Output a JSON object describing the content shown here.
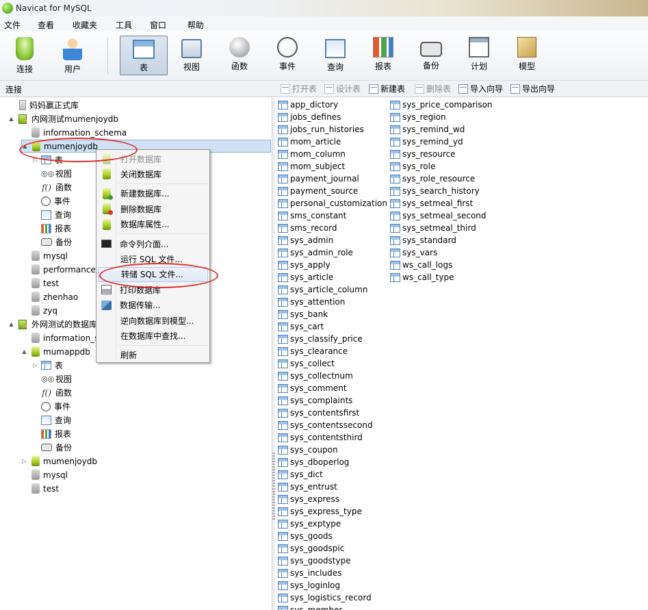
{
  "window": {
    "title": "Navicat for MySQL"
  },
  "menubar": [
    "文件",
    "查看",
    "收藏夹",
    "工具",
    "窗口",
    "帮助"
  ],
  "toolbar": [
    {
      "label": "连接",
      "icon": "connect-icon"
    },
    {
      "label": "用户",
      "icon": "user-icon"
    },
    {
      "label": "表",
      "icon": "table-icon",
      "active": true
    },
    {
      "label": "视图",
      "icon": "view-icon"
    },
    {
      "label": "函数",
      "icon": "function-icon"
    },
    {
      "label": "事件",
      "icon": "event-icon"
    },
    {
      "label": "查询",
      "icon": "query-icon"
    },
    {
      "label": "报表",
      "icon": "report-icon"
    },
    {
      "label": "备份",
      "icon": "backup-icon"
    },
    {
      "label": "计划",
      "icon": "schedule-icon"
    },
    {
      "label": "模型",
      "icon": "model-icon"
    }
  ],
  "subbar": {
    "connection_label": "连接",
    "actions": [
      {
        "label": "打开表",
        "enabled": false
      },
      {
        "label": "设计表",
        "enabled": false
      },
      {
        "label": "新建表",
        "enabled": true
      },
      {
        "label": "删除表",
        "enabled": false
      },
      {
        "label": "导入向导",
        "enabled": true
      },
      {
        "label": "导出向导",
        "enabled": true
      }
    ]
  },
  "tree": [
    {
      "label": "妈妈赢正式库",
      "icon": "connection-gray-icon",
      "level": 0,
      "expander": ""
    },
    {
      "label": "内网测试mumenjoydb",
      "icon": "connection-green-icon",
      "level": 0,
      "expander": "▲"
    },
    {
      "label": "information_schema",
      "icon": "database-gray-icon",
      "level": 1,
      "expander": ""
    },
    {
      "label": "mumenjoydb",
      "icon": "database-green-icon",
      "level": 1,
      "expander": "▲",
      "selected": true
    },
    {
      "label": "表",
      "icon": "table-icon",
      "level": 2,
      "expander": "▷"
    },
    {
      "label": "视图",
      "icon": "view-icon",
      "level": 2,
      "expander": ""
    },
    {
      "label": "函数",
      "icon": "function-icon",
      "level": 2,
      "expander": ""
    },
    {
      "label": "事件",
      "icon": "event-icon",
      "level": 2,
      "expander": ""
    },
    {
      "label": "查询",
      "icon": "query-icon",
      "level": 2,
      "expander": ""
    },
    {
      "label": "报表",
      "icon": "report-icon",
      "level": 2,
      "expander": ""
    },
    {
      "label": "备份",
      "icon": "backup-icon",
      "level": 2,
      "expander": ""
    },
    {
      "label": "mysql",
      "icon": "database-gray-icon",
      "level": 1,
      "expander": ""
    },
    {
      "label": "performance_",
      "icon": "database-gray-icon",
      "level": 1,
      "expander": ""
    },
    {
      "label": "test",
      "icon": "database-gray-icon",
      "level": 1,
      "expander": ""
    },
    {
      "label": "zhenhao",
      "icon": "database-gray-icon",
      "level": 1,
      "expander": ""
    },
    {
      "label": "zyq",
      "icon": "database-gray-icon",
      "level": 1,
      "expander": ""
    },
    {
      "label": "外网测试的数据库",
      "icon": "connection-green-icon",
      "level": 0,
      "expander": "▲"
    },
    {
      "label": "information_s",
      "icon": "database-gray-icon",
      "level": 1,
      "expander": ""
    },
    {
      "label": "mumappdb",
      "icon": "database-green-icon",
      "level": 1,
      "expander": "▲"
    },
    {
      "label": "表",
      "icon": "table-icon",
      "level": 2,
      "expander": "▷"
    },
    {
      "label": "视图",
      "icon": "view-icon",
      "level": 2,
      "expander": ""
    },
    {
      "label": "函数",
      "icon": "function-icon",
      "level": 2,
      "expander": ""
    },
    {
      "label": "事件",
      "icon": "event-icon",
      "level": 2,
      "expander": ""
    },
    {
      "label": "查询",
      "icon": "query-icon",
      "level": 2,
      "expander": ""
    },
    {
      "label": "报表",
      "icon": "report-icon",
      "level": 2,
      "expander": ""
    },
    {
      "label": "备份",
      "icon": "backup-icon",
      "level": 2,
      "expander": ""
    },
    {
      "label": "mumenjoydb",
      "icon": "database-green-icon",
      "level": 1,
      "expander": "▷"
    },
    {
      "label": "mysql",
      "icon": "database-gray-icon",
      "level": 1,
      "expander": ""
    },
    {
      "label": "test",
      "icon": "database-gray-icon",
      "level": 1,
      "expander": ""
    }
  ],
  "context_menu": [
    {
      "label": "打开数据库",
      "icon": "database-icon",
      "enabled": false
    },
    {
      "label": "关闭数据库",
      "icon": "database-icon",
      "enabled": true
    },
    {
      "separator": true
    },
    {
      "label": "新建数据库...",
      "icon": "database-add-icon",
      "enabled": true
    },
    {
      "label": "删除数据库",
      "icon": "database-delete-icon",
      "enabled": true
    },
    {
      "label": "数据库属性...",
      "icon": "database-properties-icon",
      "enabled": true
    },
    {
      "separator": true
    },
    {
      "label": "命令列介面...",
      "icon": "console-icon",
      "enabled": true
    },
    {
      "label": "运行 SQL 文件...",
      "icon": "",
      "enabled": true
    },
    {
      "label": "转储 SQL 文件...",
      "icon": "",
      "enabled": true,
      "highlighted": true
    },
    {
      "label": "打印数据库",
      "icon": "print-icon",
      "enabled": true
    },
    {
      "label": "数据传输...",
      "icon": "transfer-icon",
      "enabled": true
    },
    {
      "label": "逆向数据库到模型...",
      "icon": "",
      "enabled": true
    },
    {
      "label": "在数据库中查找...",
      "icon": "",
      "enabled": true
    },
    {
      "separator": true
    },
    {
      "label": "刷新",
      "icon": "",
      "enabled": true
    }
  ],
  "tables_col1": [
    "app_dictory",
    "jobs_defines",
    "jobs_run_histories",
    "mom_article",
    "mom_column",
    "mom_subject",
    "payment_journal",
    "payment_source",
    "personal_customization",
    "sms_constant",
    "sms_record",
    "sys_admin",
    "sys_admin_role",
    "sys_apply",
    "sys_article",
    "sys_article_column",
    "sys_attention",
    "sys_bank",
    "sys_cart",
    "sys_classify_price",
    "sys_clearance",
    "sys_collect",
    "sys_collectnum",
    "sys_comment",
    "sys_complaints",
    "sys_contentsfirst",
    "sys_contentssecond",
    "sys_contentsthird",
    "sys_coupon",
    "sys_dboperlog",
    "sys_dict",
    "sys_entrust",
    "sys_express",
    "sys_express_type",
    "sys_exptype",
    "sys_goods",
    "sys_goodspic",
    "sys_goodstype",
    "sys_includes",
    "sys_loginlog",
    "sys_logistics_record",
    "sys_member"
  ],
  "tables_col2": [
    "sys_price_comparison",
    "sys_region",
    "sys_remind_wd",
    "sys_remind_yd",
    "sys_resource",
    "sys_role",
    "sys_role_resource",
    "sys_search_history",
    "sys_setmeal_first",
    "sys_setmeal_second",
    "sys_setmeal_third",
    "sys_standard",
    "sys_vars",
    "ws_call_logs",
    "ws_call_type"
  ],
  "annotation_color": "#e02c2c"
}
